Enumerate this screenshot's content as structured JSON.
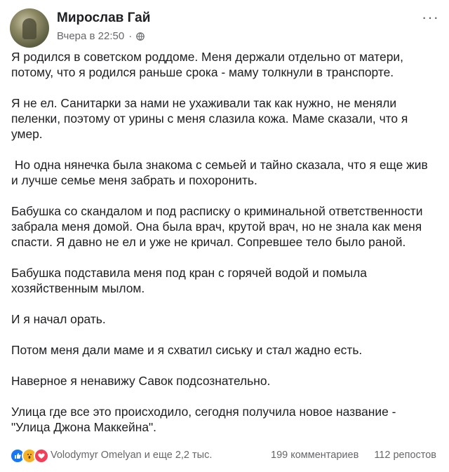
{
  "post": {
    "author": "Мирослав Гай",
    "timestamp": "Вчера в 22:50",
    "privacy_separator": "·",
    "privacy_icon": "globe-icon",
    "more_icon": "more-icon",
    "paragraphs": [
      "Я родился в советском роддоме. Меня держали отдельно от матери, потому, что я родился раньше срока - маму толкнули в транспорте.",
      "Я не ел. Санитарки за нами не ухаживали так как нужно, не меняли пеленки, поэтому от урины с меня слазила кожа. Маме сказали, что я умер.",
      " Но одна нянечка была знакома с семьей и тайно сказала, что я еще жив и лучше семье меня забрать и похоронить.",
      "Бабушка со скандалом и под расписку о криминальной ответственности забрала меня домой. Она была врач, крутой врач, но не знала как меня спасти. Я давно не ел и уже не кричал. Сопревшее тело было раной.",
      "Бабушка подставила меня под кран с горячей водой и помыла хозяйственным мылом.",
      "И я начал орать.",
      "Потом меня дали маме и я схватил сиську и стал жадно есть.",
      "Наверное я ненавижу Савок подсознательно.",
      "Улица где все это происходило, сегодня получила новое название - \"Улица Джона Маккейна\"."
    ]
  },
  "footer": {
    "reaction_icons": [
      "like-icon",
      "wow-icon",
      "love-icon"
    ],
    "reacted_by": "Volodymyr Omelyan и еще 2,2 тыс.",
    "comments": "199 комментариев",
    "shares": "112 репостов"
  },
  "colors": {
    "text": "#1c1e21",
    "secondary": "#65676b",
    "like": "#1877f2",
    "wow": "#f7b125",
    "love": "#f33e58"
  }
}
